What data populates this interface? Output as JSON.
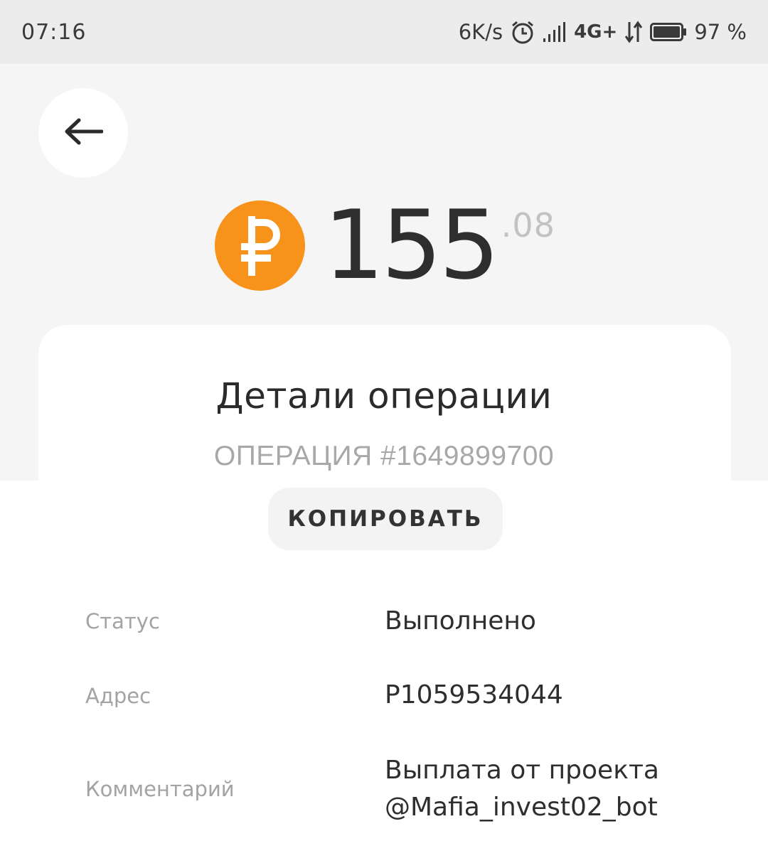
{
  "status_bar": {
    "time": "07:16",
    "speed": "6K/s",
    "network": "4G+",
    "battery": "97 %",
    "icons": [
      "alarm-icon",
      "signal-icon",
      "data-arrows-icon",
      "battery-icon"
    ]
  },
  "header": {
    "back_icon": "arrow-left-icon"
  },
  "amount": {
    "integer": "155",
    "fraction": ".08",
    "currency_icon": "ruble-coin-icon",
    "coin_color": "#f7931a"
  },
  "details": {
    "title": "Детали операции",
    "operation_number": "ОПЕРАЦИЯ #1649899700",
    "copy_label": "КОПИРОВАТЬ",
    "rows": [
      {
        "label": "Статус",
        "value": "Выполнено"
      },
      {
        "label": "Адрес",
        "value": "P1059534044"
      },
      {
        "label": "Комментарий",
        "value_line1": "Выплата от проекта",
        "value_line2": "@Mafia_invest02_bot"
      }
    ]
  }
}
